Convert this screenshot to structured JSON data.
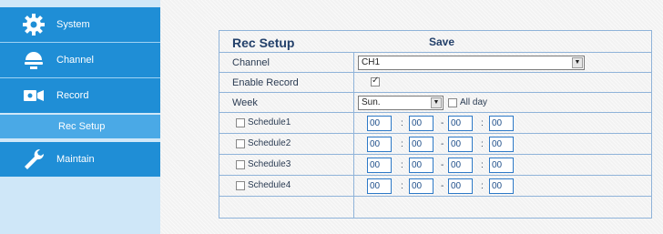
{
  "sidebar": {
    "items": [
      {
        "label": "System",
        "icon": "gear-icon"
      },
      {
        "label": "Channel",
        "icon": "dome-camera-icon"
      },
      {
        "label": "Record",
        "icon": "video-camera-icon"
      },
      {
        "label": "Maintain",
        "icon": "wrench-icon"
      }
    ],
    "subitems": [
      {
        "label": "Rec Setup"
      }
    ]
  },
  "panel": {
    "title": "Rec Setup",
    "save_label": "Save",
    "channel": {
      "label": "Channel",
      "value": "CH1"
    },
    "enable_record": {
      "label": "Enable Record",
      "checked": true
    },
    "week": {
      "label": "Week",
      "value": "Sun.",
      "allday_label": "All day",
      "allday_checked": false
    },
    "schedules": [
      {
        "label": "Schedule1",
        "checked": false,
        "start_h": "00",
        "start_m": "00",
        "end_h": "00",
        "end_m": "00"
      },
      {
        "label": "Schedule2",
        "checked": false,
        "start_h": "00",
        "start_m": "00",
        "end_h": "00",
        "end_m": "00"
      },
      {
        "label": "Schedule3",
        "checked": false,
        "start_h": "00",
        "start_m": "00",
        "end_h": "00",
        "end_m": "00"
      },
      {
        "label": "Schedule4",
        "checked": false,
        "start_h": "00",
        "start_m": "00",
        "end_h": "00",
        "end_m": "00"
      }
    ],
    "separators": {
      "colon": ":",
      "dash": "-"
    }
  },
  "colors": {
    "sidebar_active": "#1f8ed6",
    "sidebar_sub": "#4aa9e6",
    "sidebar_bg": "#cfe7f8",
    "border": "#8fb3d9",
    "title": "#23406a"
  }
}
